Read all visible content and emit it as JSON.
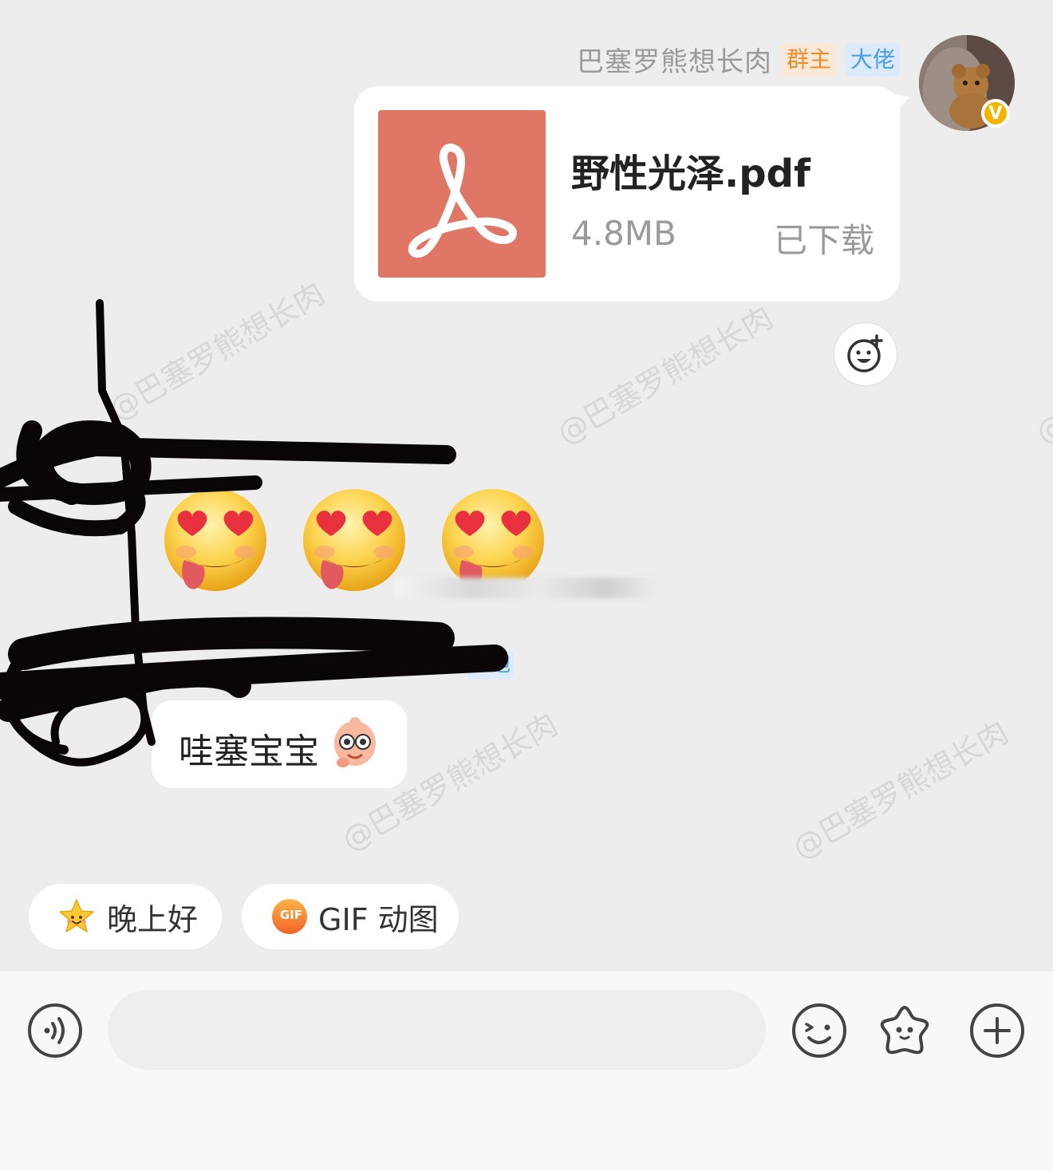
{
  "sender": {
    "name": "巴塞罗熊想长肉",
    "tags": [
      "群主",
      "大佬"
    ]
  },
  "file_message": {
    "file_name": "野性光泽.pdf",
    "file_size": "4.8MB",
    "status": "已下载"
  },
  "watermark": "@巴塞罗熊想长肉",
  "partial_tag": "泡",
  "text_message": {
    "text": "哇塞宝宝"
  },
  "quick_replies": [
    {
      "label": "晚上好",
      "icon": "star-face-icon"
    },
    {
      "label": "GIF 动图",
      "icon": "gif-icon",
      "badge": "GIF"
    }
  ],
  "input_bar": {
    "placeholder": ""
  },
  "colors": {
    "pdf_red": "#e07666",
    "owner_tag": "#f08a2c",
    "boss_tag": "#4a9ee8",
    "background": "#ededed"
  }
}
